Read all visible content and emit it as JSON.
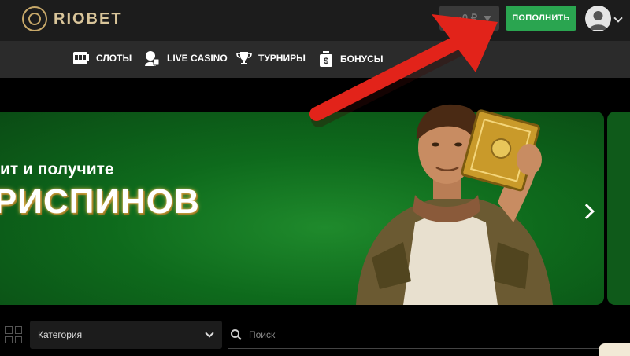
{
  "header": {
    "logo_text": "RIOBET",
    "balance_text": "···0 ₽",
    "deposit_label": "ПОПОЛНИТЬ",
    "accent_green": "#2aa550",
    "logo_gold": "#d9c59a"
  },
  "nav": {
    "items": [
      {
        "label": "СЛОТЫ",
        "icon": "slot-machine-icon"
      },
      {
        "label": "LIVE CASINO",
        "icon": "live-dealer-icon"
      },
      {
        "label": "ТУРНИРЫ",
        "icon": "trophy-icon"
      },
      {
        "label": "БОНУСЫ",
        "icon": "bonus-bag-icon"
      }
    ]
  },
  "banner": {
    "line1": "ит и получите",
    "line2": "РИСПИНОВ",
    "background": "#0e6a1c"
  },
  "filters": {
    "category_label": "Категория",
    "search_placeholder": "Поиск"
  },
  "annotation": {
    "arrow_color": "#e2231a"
  }
}
